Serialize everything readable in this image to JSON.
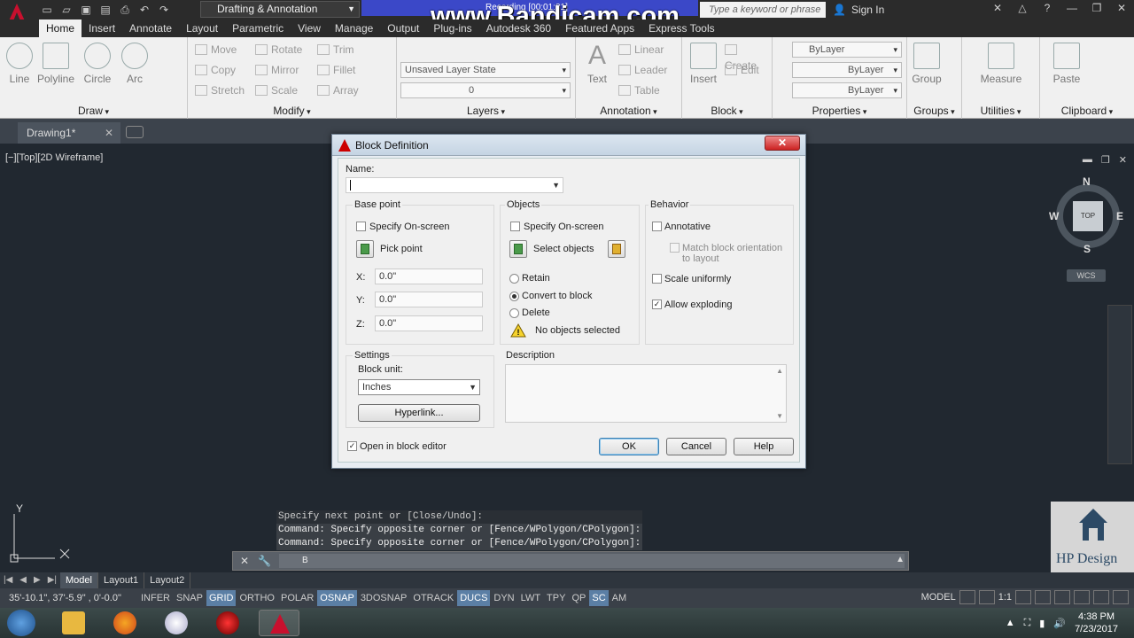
{
  "titlebar": {
    "workspace": "Drafting & Annotation",
    "watermark": "www.Bandicam.com",
    "recording": "Recording [00:01:31]",
    "search_placeholder": "Type a keyword or phrase",
    "signin": "Sign In"
  },
  "ribbon": {
    "tabs": [
      "Home",
      "Insert",
      "Annotate",
      "Layout",
      "Parametric",
      "View",
      "Manage",
      "Output",
      "Plug-ins",
      "Autodesk 360",
      "Featured Apps",
      "Express Tools"
    ],
    "draw": {
      "title": "Draw",
      "line": "Line",
      "polyline": "Polyline",
      "circle": "Circle",
      "arc": "Arc"
    },
    "modify": {
      "title": "Modify",
      "move": "Move",
      "rotate": "Rotate",
      "trim": "Trim",
      "copy": "Copy",
      "mirror": "Mirror",
      "fillet": "Fillet",
      "stretch": "Stretch",
      "scale": "Scale",
      "array": "Array"
    },
    "layers": {
      "title": "Layers",
      "layer_state": "Unsaved Layer State",
      "current_layer": "0"
    },
    "annotation": {
      "title": "Annotation",
      "text": "Text",
      "linear": "Linear",
      "leader": "Leader",
      "table": "Table"
    },
    "block": {
      "title": "Block",
      "insert": "Insert",
      "create": "Create",
      "edit": "Edit"
    },
    "properties": {
      "title": "Properties",
      "color": "ByLayer",
      "linetype": "ByLayer",
      "lineweight": "ByLayer"
    },
    "groups": {
      "title": "Groups",
      "group": "Group"
    },
    "utilities": {
      "title": "Utilities",
      "measure": "Measure"
    },
    "clipboard": {
      "title": "Clipboard",
      "paste": "Paste"
    }
  },
  "document": {
    "tab": "Drawing1*"
  },
  "viewport": {
    "label": "[−][Top][2D Wireframe]",
    "viewcube": {
      "n": "N",
      "s": "S",
      "e": "E",
      "w": "W",
      "face": "TOP",
      "wcs": "WCS"
    },
    "ucs_y": "Y"
  },
  "dialog": {
    "title": "Block Definition",
    "close": "✕",
    "name_label": "Name:",
    "name_value": "",
    "base_point": {
      "title": "Base point",
      "specify_onscreen": "Specify On-screen",
      "pick_point": "Pick point",
      "x_label": "X:",
      "x_value": "0.0\"",
      "y_label": "Y:",
      "y_value": "0.0\"",
      "z_label": "Z:",
      "z_value": "0.0\""
    },
    "objects": {
      "title": "Objects",
      "specify_onscreen": "Specify On-screen",
      "select_objects": "Select objects",
      "retain": "Retain",
      "convert": "Convert to block",
      "delete": "Delete",
      "status": "No objects selected"
    },
    "behavior": {
      "title": "Behavior",
      "annotative": "Annotative",
      "match_orientation_1": "Match block orientation",
      "match_orientation_2": "to layout",
      "scale_uniformly": "Scale uniformly",
      "allow_exploding": "Allow exploding"
    },
    "settings": {
      "title": "Settings",
      "block_unit_label": "Block unit:",
      "block_unit_value": "Inches",
      "hyperlink": "Hyperlink..."
    },
    "description": {
      "title": "Description",
      "value": ""
    },
    "open_in_editor": "Open in block editor",
    "ok": "OK",
    "cancel": "Cancel",
    "help": "Help"
  },
  "command": {
    "history": [
      "Specify next point or [Close/Undo]:",
      "Command: Specify opposite corner or [Fence/WPolygon/CPolygon]:",
      "Command: Specify opposite corner or [Fence/WPolygon/CPolygon]:"
    ],
    "input": "B"
  },
  "layout_tabs": [
    "Model",
    "Layout1",
    "Layout2"
  ],
  "statusbar": {
    "coords": "35'-10.1\", 37'-5.9\" , 0'-0.0\"",
    "toggles": [
      {
        "label": "INFER",
        "on": false
      },
      {
        "label": "SNAP",
        "on": false
      },
      {
        "label": "GRID",
        "on": true
      },
      {
        "label": "ORTHO",
        "on": false
      },
      {
        "label": "POLAR",
        "on": false
      },
      {
        "label": "OSNAP",
        "on": true
      },
      {
        "label": "3DOSNAP",
        "on": false
      },
      {
        "label": "OTRACK",
        "on": false
      },
      {
        "label": "DUCS",
        "on": true
      },
      {
        "label": "DYN",
        "on": false
      },
      {
        "label": "LWT",
        "on": false
      },
      {
        "label": "TPY",
        "on": false
      },
      {
        "label": "QP",
        "on": false
      },
      {
        "label": "SC",
        "on": true
      },
      {
        "label": "AM",
        "on": false
      }
    ],
    "model": "MODEL",
    "scale": "1:1"
  },
  "branding": {
    "hp_design": "HP Design"
  },
  "taskbar": {
    "time": "4:38 PM",
    "date": "7/23/2017"
  },
  "colors": {
    "autocad_red": "#c8102e",
    "accent_blue": "#5b7fa5",
    "bandicam_bar": "#3b48c8"
  }
}
